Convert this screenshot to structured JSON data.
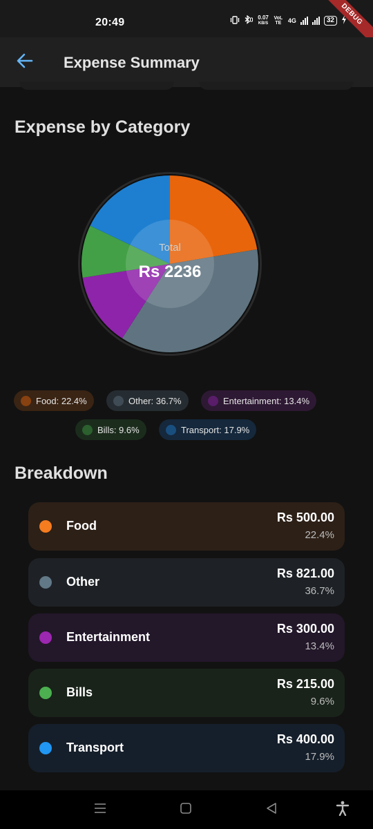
{
  "status_bar": {
    "time": "20:49",
    "speed_value": "0.07",
    "speed_unit": "KB/S",
    "volte": "VoLTE",
    "network": "4G",
    "battery": "32",
    "debug_banner": "DEBUG"
  },
  "app_bar": {
    "title": "Expense Summary"
  },
  "category_section": {
    "title": "Expense by Category"
  },
  "chart_data": {
    "type": "pie",
    "center_caption": "Total",
    "center_value": "Rs 2236",
    "total": 2236,
    "slices": [
      {
        "name": "Food",
        "value": 500.0,
        "percent": 22.4,
        "color": "#e8650c"
      },
      {
        "name": "Other",
        "value": 821.0,
        "percent": 36.7,
        "color": "#5f7480"
      },
      {
        "name": "Entertainment",
        "value": 300.0,
        "percent": 13.4,
        "color": "#8e24aa"
      },
      {
        "name": "Bills",
        "value": 215.0,
        "percent": 9.6,
        "color": "#43a047"
      },
      {
        "name": "Transport",
        "value": 400.0,
        "percent": 17.9,
        "color": "#1e7fd0"
      }
    ]
  },
  "legend": [
    {
      "label": "Food: 22.4%",
      "color": "#e8650c",
      "bg": "#3a2414"
    },
    {
      "label": "Other: 36.7%",
      "color": "#5f7480",
      "bg": "#262d32"
    },
    {
      "label": "Entertainment: 13.4%",
      "color": "#8e24aa",
      "bg": "#2e1934"
    },
    {
      "label": "Bills: 9.6%",
      "color": "#43a047",
      "bg": "#1b2c1c"
    },
    {
      "label": "Transport: 17.9%",
      "color": "#1e7fd0",
      "bg": "#15283c"
    }
  ],
  "breakdown_section": {
    "title": "Breakdown"
  },
  "breakdown": [
    {
      "name": "Food",
      "amount": "Rs 500.00",
      "percent": "22.4%",
      "color": "#f57c1f",
      "bg": "#2d2017"
    },
    {
      "name": "Other",
      "amount": "Rs 821.00",
      "percent": "36.7%",
      "color": "#627987",
      "bg": "#1e2226"
    },
    {
      "name": "Entertainment",
      "amount": "Rs 300.00",
      "percent": "13.4%",
      "color": "#9c27b0",
      "bg": "#23172a"
    },
    {
      "name": "Bills",
      "amount": "Rs 215.00",
      "percent": "9.6%",
      "color": "#4caf50",
      "bg": "#19231a"
    },
    {
      "name": "Transport",
      "amount": "Rs 400.00",
      "percent": "17.9%",
      "color": "#2196f3",
      "bg": "#151f2b"
    }
  ],
  "icons": {
    "back": "arrow-left-icon",
    "nav_menu": "menu-icon",
    "nav_home": "square-icon",
    "nav_back": "triangle-back-icon",
    "accessibility": "accessibility-icon"
  }
}
